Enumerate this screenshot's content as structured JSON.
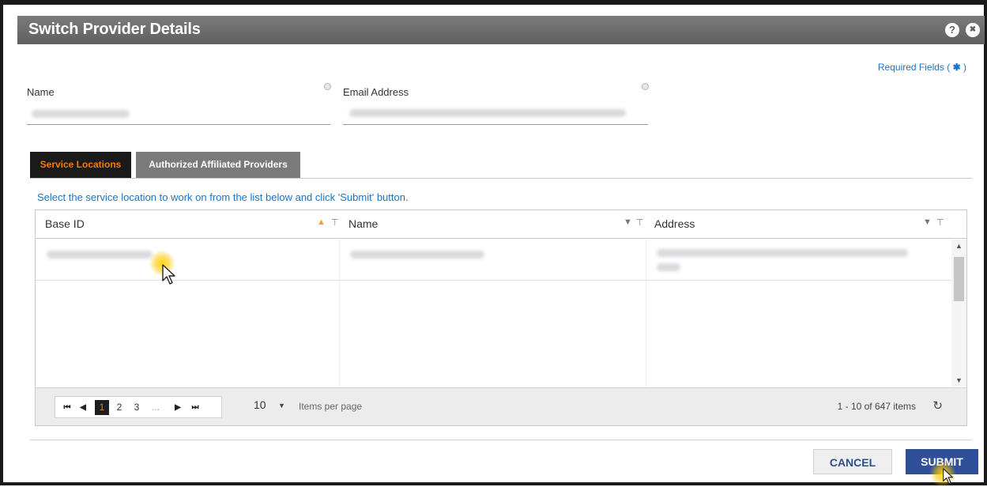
{
  "dialog": {
    "title": "Switch Provider Details",
    "help_icon": "?",
    "close_icon": "✖"
  },
  "required_fields": {
    "text": "Required Fields (",
    "star": "✱",
    "end": ")"
  },
  "form": {
    "name_label": "Name",
    "email_label": "Email Address"
  },
  "tabs": [
    {
      "label": "Service Locations",
      "active": true
    },
    {
      "label": "Authorized Affiliated Providers",
      "active": false
    }
  ],
  "hint": "Select the service location to work on from the list below and click 'Submit' button.",
  "grid": {
    "columns": [
      "Base ID",
      "Name",
      "Address"
    ],
    "sort_icon_up": "▲",
    "sort_icon_down": "▼",
    "filter_icon": "⊤"
  },
  "pager": {
    "first": "⏮",
    "prev": "◀",
    "pages": [
      "1",
      "2",
      "3",
      "..."
    ],
    "next": "▶",
    "last": "⏭",
    "page_size": "10",
    "dropdown_arrow": "▼",
    "items_per_page": "Items per page",
    "info": "1 - 10 of 647 items",
    "refresh_icon": "↻"
  },
  "buttons": {
    "cancel": "CANCEL",
    "submit": "SUBMIT"
  }
}
